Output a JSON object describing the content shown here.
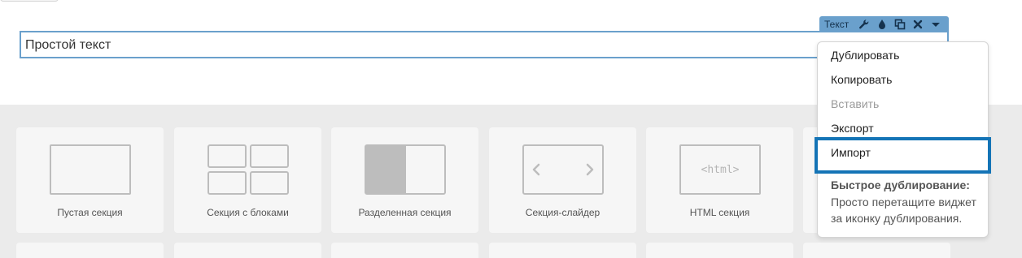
{
  "widget": {
    "text": "Простой текст"
  },
  "toolbar": {
    "label": "Текст",
    "icons": [
      "wrench-icon",
      "drop-icon",
      "duplicate-icon",
      "close-icon",
      "caret-down-icon"
    ],
    "color": "#6aa0cc"
  },
  "menu": {
    "items": [
      {
        "label": "Дублировать",
        "enabled": true
      },
      {
        "label": "Копировать",
        "enabled": true
      },
      {
        "label": "Вставить",
        "enabled": false
      },
      {
        "label": "Экспорт",
        "enabled": true
      },
      {
        "label": "Импорт",
        "enabled": true,
        "highlighted": true
      }
    ],
    "hint_title": "Быстрое дублирование:",
    "hint_body": "Просто перетащите виджет за иконку дублирования."
  },
  "sections": [
    {
      "label": "Пустая секция",
      "icon": "empty-section-icon"
    },
    {
      "label": "Секция с блоками",
      "icon": "blocks-section-icon"
    },
    {
      "label": "Разделенная секция",
      "icon": "split-section-icon"
    },
    {
      "label": "Секция-слайдер",
      "icon": "slider-section-icon"
    },
    {
      "label": "HTML секция",
      "icon": "html-section-icon",
      "icon_text": "<html>"
    }
  ],
  "colors": {
    "accent": "#6aa0cc",
    "highlight_border": "#1474b6",
    "canvas_gray": "#ebebeb"
  }
}
